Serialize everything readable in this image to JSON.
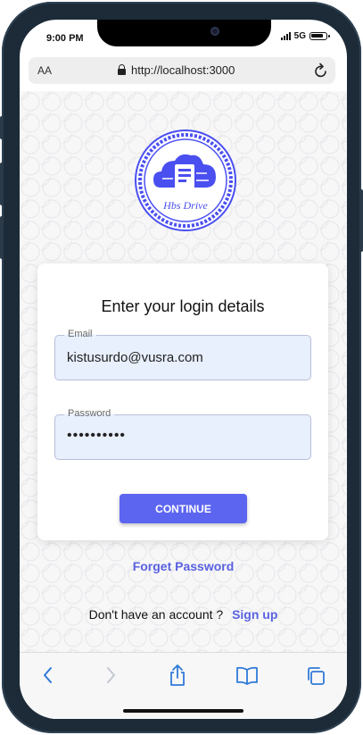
{
  "status_bar": {
    "time": "9:00 PM",
    "network": "5G"
  },
  "browser": {
    "text_size_label": "AA",
    "url": "http://localhost:3000"
  },
  "logo": {
    "text": "Hbs Drive"
  },
  "login": {
    "title": "Enter your login details",
    "email_label": "Email",
    "email_value": "kistusurdo@vusra.com",
    "password_label": "Password",
    "password_value": "••••••••••",
    "continue_label": "CONTINUE",
    "forget_label": "Forget Password",
    "no_account_text": "Don't have an account ?",
    "signup_label": "Sign up"
  },
  "colors": {
    "accent": "#5c65f0",
    "link": "#5a62e0",
    "field_bg": "#e8effd",
    "logo": "#4a4ff0"
  },
  "toolbar_icons": [
    "back-icon",
    "forward-icon",
    "share-icon",
    "bookmarks-icon",
    "tabs-icon"
  ]
}
